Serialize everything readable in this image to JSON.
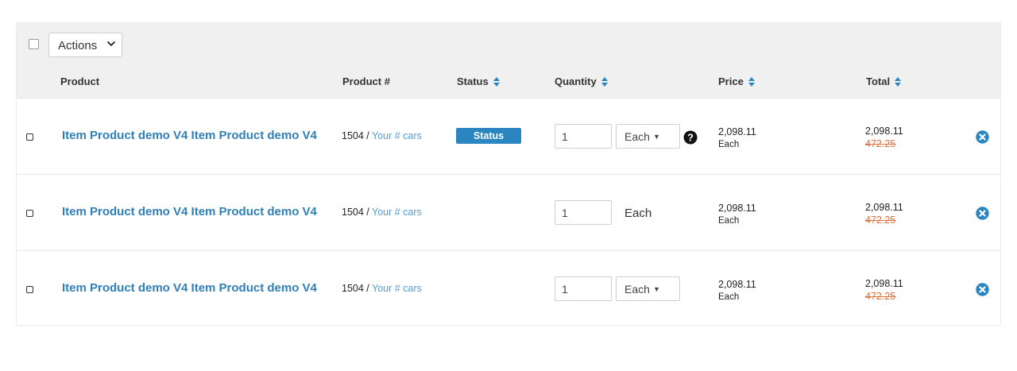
{
  "toolbar": {
    "actions_label": "Actions"
  },
  "columns": {
    "product": "Product",
    "product_num": "Product #",
    "status": "Status",
    "quantity": "Quantity",
    "price": "Price",
    "total": "Total"
  },
  "rows": [
    {
      "name": "Item Product demo V4 Item Product demo V4",
      "num": "1504",
      "sep": " / ",
      "link": "Your # cars",
      "status": "Status",
      "qty": "1",
      "unit": "Each",
      "unit_type": "select",
      "help": true,
      "price": "2,098.11",
      "price_unit": "Each",
      "total": "2,098.11",
      "total_old": "472.25"
    },
    {
      "name": "Item Product demo V4 Item Product demo V4",
      "num": "1504",
      "sep": " / ",
      "link": "Your # cars",
      "status": "",
      "qty": "1",
      "unit": "Each",
      "unit_type": "text",
      "help": false,
      "price": "2,098.11",
      "price_unit": "Each",
      "total": "2,098.11",
      "total_old": "472.25"
    },
    {
      "name": "Item Product demo V4 Item Product demo V4",
      "num": "1504",
      "sep": " / ",
      "link": "Your # cars",
      "status": "",
      "qty": "1",
      "unit": "Each",
      "unit_type": "select",
      "help": false,
      "price": "2,098.11",
      "price_unit": "Each",
      "total": "2,098.11",
      "total_old": "472.25"
    }
  ],
  "colors": {
    "accent": "#2a85c1",
    "link": "#2f7fb8",
    "strike": "#e0713b",
    "header_bg": "#f0f0f0"
  }
}
